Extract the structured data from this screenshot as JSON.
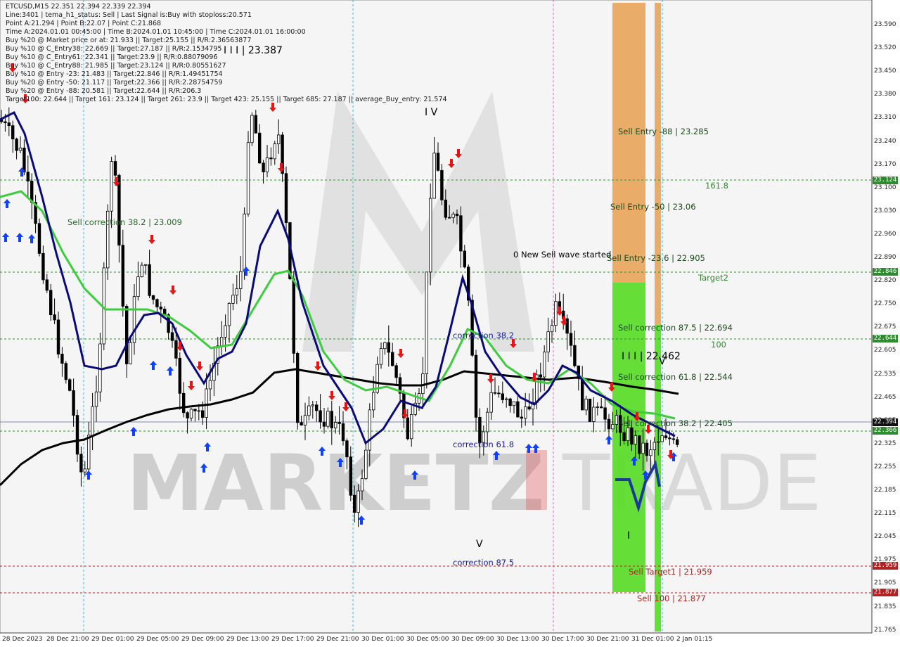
{
  "header": {
    "symbol_line": "ETCUSD,M15  22.351 22.394 22.339 22.394",
    "info_lines": [
      "Line:3401 | tema_h1_status: Sell | Last Signal is:Buy with stoploss:20.571",
      "Point A:21.294 | Point B:22.07 | Point C:21.868",
      "Time A:2024.01.01 00:45:00 | Time B:2024.01.01 10:45:00 | Time C:2024.01.01 16:00:00",
      "Buy %20 @ Market price or at: 21.933 || Target:25.155 || R/R:2.36563877",
      "Buy %10 @ C_Entry38: 22.669 || Target:27.187 || R/R:2.1534795",
      "Buy %10 @ C_Entry61: 22.341 || Target:23.9 || R/R:0.88079096",
      "Buy %10 @ C_Entry88: 21.985 || Target:23.124 || R/R:0.80551627",
      "Buy %10 @ Entry -23: 21.483 || Target:22.846 || R/R:1.49451754",
      "Buy %20 @ Entry -50: 21.117 || Target:22.366 || R/R:2.28754759",
      "Buy %20 @ Entry -88: 20.581 || Target:22.644 || R/R:206.3",
      "Target100: 22.644 || Target 161: 23.124 || Target 261: 23.9 || Target 423: 25.155 || Target 685: 27.187 || average_Buy_entry: 21.574"
    ]
  },
  "watermark": {
    "text": "MARKETZ",
    "text2": "TRADE"
  },
  "annotations": {
    "wave_III_top": "I I I | 23.387",
    "wave_IV": "I V",
    "wave_V": "V",
    "wave_III_right": "I I I | 22.462",
    "wave_V_right": "V",
    "wave_I": "I",
    "sell_correction_382": "Sell correction 38.2 | 23.009",
    "new_sell_wave": "0 New Sell wave started",
    "correction_382": "correction 38.2",
    "correction_618": "correction 61.8",
    "correction_875": "correction 87.5",
    "sell_entry_88": "Sell Entry -88 | 23.285",
    "sell_entry_50": "Sell Entry -50 | 23.06",
    "sell_entry_236": "Sell Entry -23.6 | 22.905",
    "sell_corr_875": "Sell correction 87.5 | 22.694",
    "sell_corr_618": "Sell correction 61.8 | 22.544",
    "sell_corr_382_right": "Sell correction 38.2 | 22.405",
    "sell_target1": "Sell Target1 | 21.959",
    "sell_target100": "Sell 100 | 21.877",
    "lvl_1618": "161.8",
    "lvl_target2": "Target2",
    "lvl_100": "100"
  },
  "price_labels": {
    "p_23124": "23.124",
    "p_22846": "22.846",
    "p_22644": "22.644",
    "p_22394": "22.394",
    "p_22366": "22.366",
    "p_21959": "21.959",
    "p_21877": "21.877"
  },
  "y_axis": [
    "23.590",
    "23.520",
    "23.450",
    "23.380",
    "23.310",
    "23.240",
    "23.170",
    "23.100",
    "23.030",
    "22.960",
    "22.890",
    "22.820",
    "22.750",
    "22.675",
    "22.605",
    "22.535",
    "22.465",
    "22.395",
    "22.325",
    "22.255",
    "22.185",
    "22.115",
    "22.045",
    "21.975",
    "21.905",
    "21.835",
    "21.765"
  ],
  "x_axis": [
    "28 Dec 2023",
    "28 Dec 21:00",
    "29 Dec 01:00",
    "29 Dec 05:00",
    "29 Dec 09:00",
    "29 Dec 13:00",
    "29 Dec 17:00",
    "29 Dec 21:00",
    "30 Dec 01:00",
    "30 Dec 05:00",
    "30 Dec 09:00",
    "30 Dec 13:00",
    "30 Dec 17:00",
    "30 Dec 21:00",
    "31 Dec 01:00",
    "2 Jan 01:15"
  ],
  "colors": {
    "bull_candle": "#ffffff",
    "bear_candle": "#000000",
    "grid_green": "#2e8b2e",
    "grid_red": "#b22222",
    "ma_black": "#000000",
    "ma_navy": "#0a0a7a",
    "ma_green": "#3dcc3d",
    "sell_zone_orange": "#e8a050",
    "sell_zone_green": "#55dd22",
    "buy_arrow": "#1040ff",
    "sell_arrow": "#ee1111"
  }
}
